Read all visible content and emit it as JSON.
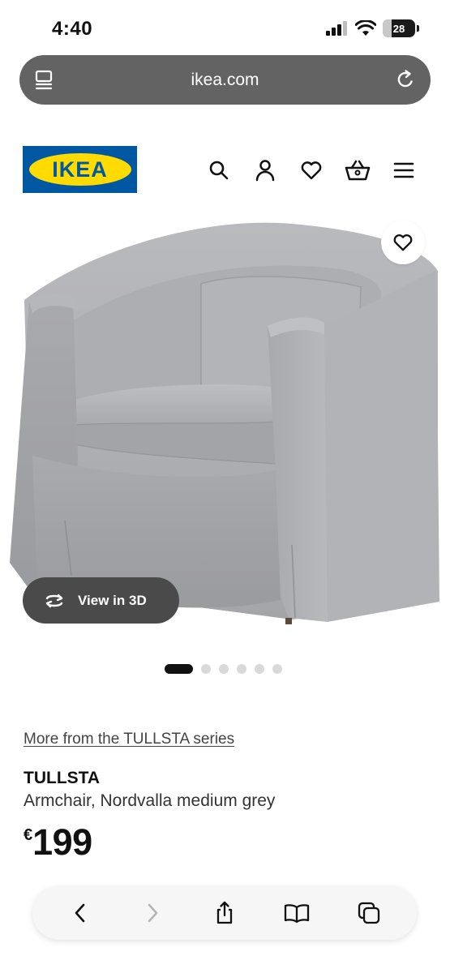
{
  "status_bar": {
    "time": "4:40",
    "battery": "28",
    "battery_level": 0.28
  },
  "browser": {
    "url": "ikea.com"
  },
  "header": {
    "logo_text": "IKEA",
    "icons": [
      "search-icon",
      "user-icon",
      "heart-icon",
      "basket-icon",
      "menu-icon"
    ]
  },
  "product": {
    "view_3d_label": "View in 3D",
    "image_count": 6,
    "current_image": 1,
    "series_link": "More from the TULLSTA series",
    "name": "TULLSTA",
    "description": "Armchair, Nordvalla medium grey",
    "price_currency": "€",
    "price_value": "199"
  },
  "toolbar": {
    "icons": [
      "back-icon",
      "forward-icon",
      "share-icon",
      "bookmarks-icon",
      "tabs-icon"
    ]
  },
  "colors": {
    "ikea_blue": "#0058a3",
    "ikea_yellow": "#ffdb00",
    "url_bar": "#636363"
  }
}
